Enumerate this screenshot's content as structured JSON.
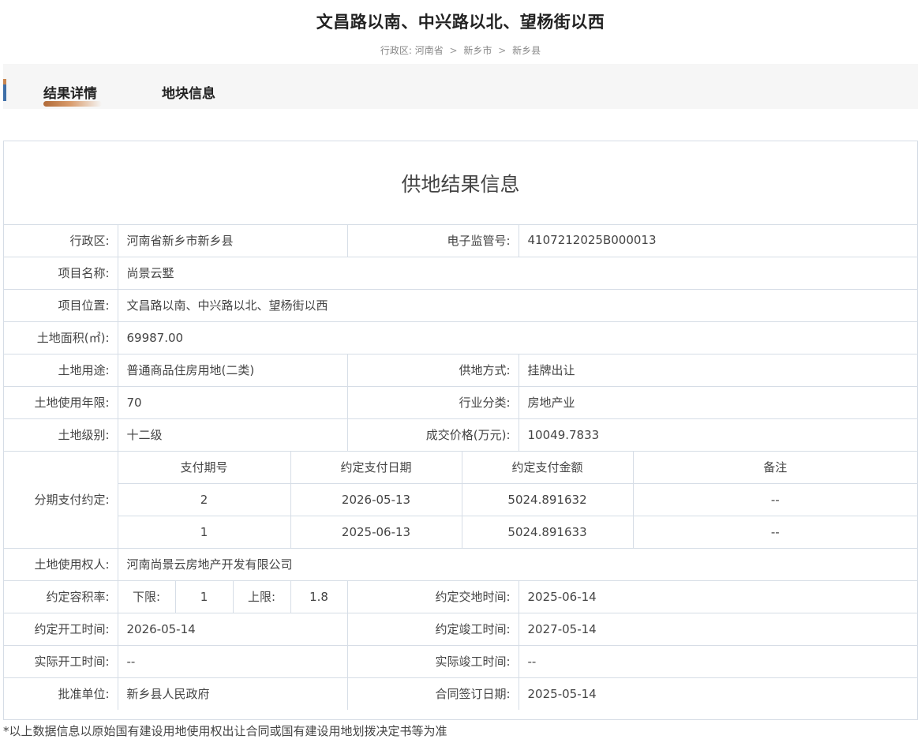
{
  "header": {
    "title": "文昌路以南、中兴路以北、望杨街以西",
    "breadcrumb_label": "行政区:",
    "breadcrumb": [
      "河南省",
      "新乡市",
      "新乡县"
    ],
    "breadcrumb_sep": ">"
  },
  "tabs": [
    {
      "label": "结果详情",
      "active": true
    },
    {
      "label": "地块信息",
      "active": false
    }
  ],
  "section_title": "供地结果信息",
  "fields": {
    "region_label": "行政区:",
    "region": "河南省新乡市新乡县",
    "supervision_no_label": "电子监管号:",
    "supervision_no": "4107212025B000013",
    "project_name_label": "项目名称:",
    "project_name": "尚景云墅",
    "project_location_label": "项目位置:",
    "project_location": "文昌路以南、中兴路以北、望杨街以西",
    "land_area_label": "土地面积(㎡):",
    "land_area": "69987.00",
    "land_use_label": "土地用途:",
    "land_use": "普通商品住房用地(二类)",
    "supply_method_label": "供地方式:",
    "supply_method": "挂牌出让",
    "use_years_label": "土地使用年限:",
    "use_years": "70",
    "industry_label": "行业分类:",
    "industry": "房地产业",
    "land_level_label": "土地级别:",
    "land_level": "十二级",
    "price_label": "成交价格(万元):",
    "price": "10049.7833",
    "installment_label": "分期支付约定:",
    "installment_headers": [
      "支付期号",
      "约定支付日期",
      "约定支付金额",
      "备注"
    ],
    "installments": [
      {
        "period": "2",
        "date": "2026-05-13",
        "amount": "5024.891632",
        "remark": "--"
      },
      {
        "period": "1",
        "date": "2025-06-13",
        "amount": "5024.891633",
        "remark": "--"
      }
    ],
    "land_user_label": "土地使用权人:",
    "land_user": "河南尚景云房地产开发有限公司",
    "far_label": "约定容积率:",
    "far_lower_label": "下限:",
    "far_lower": "1",
    "far_upper_label": "上限:",
    "far_upper": "1.8",
    "handover_label": "约定交地时间:",
    "handover": "2025-06-14",
    "start_label": "约定开工时间:",
    "start": "2026-05-14",
    "finish_label": "约定竣工时间:",
    "finish": "2027-05-14",
    "actual_start_label": "实际开工时间:",
    "actual_start": "--",
    "actual_finish_label": "实际竣工时间:",
    "actual_finish": "--",
    "approver_label": "批准单位:",
    "approver": "新乡县人民政府",
    "contract_date_label": "合同签订日期:",
    "contract_date": "2025-05-14"
  },
  "footnote": "*以上数据信息以原始国有建设用地使用权出让合同或国有建设用地划拨决定书等为准"
}
